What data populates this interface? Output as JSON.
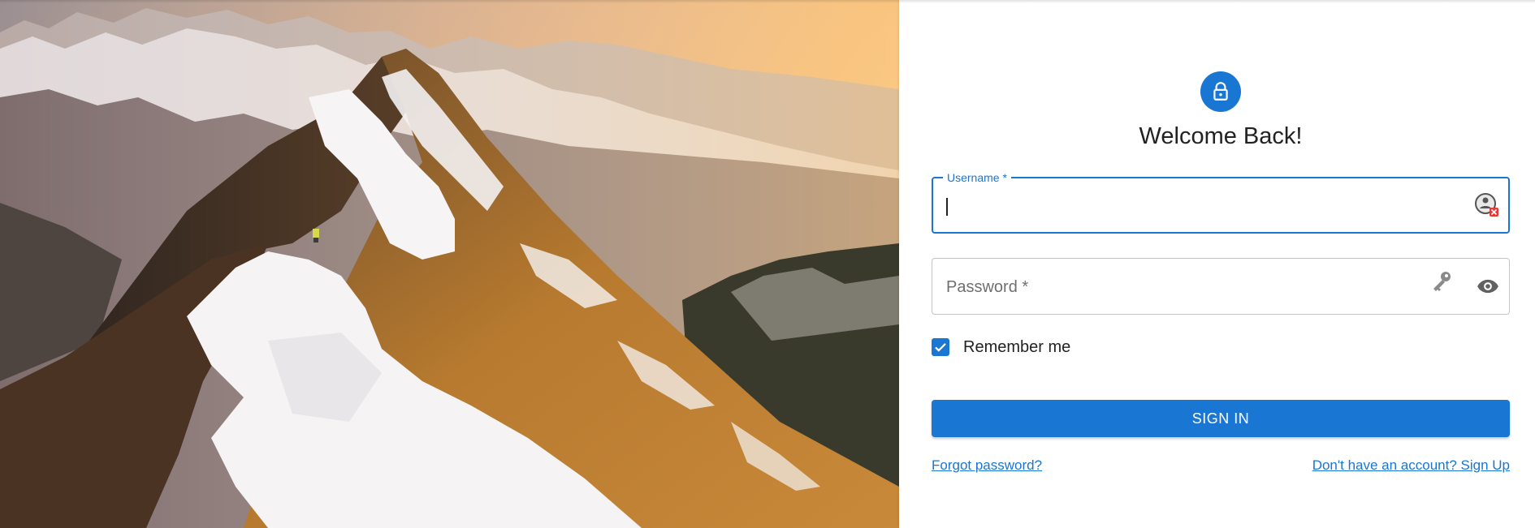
{
  "colors": {
    "primary": "#1976d2",
    "text": "#222222",
    "placeholder": "#6f6f6f",
    "border": "#c4c4c4"
  },
  "hero": {
    "description_icon": "mountain-photo"
  },
  "header": {
    "avatar_icon": "lock-icon",
    "title": "Welcome Back!"
  },
  "form": {
    "username": {
      "label": "Username *",
      "value": "",
      "autofill_icon": "password-manager-icon"
    },
    "password": {
      "label": "Password *",
      "value": "",
      "key_icon": "key-icon",
      "visibility_icon": "eye-icon"
    },
    "remember": {
      "label": "Remember me",
      "checked": true
    },
    "submit_label": "SIGN IN"
  },
  "links": {
    "forgot": "Forgot password?",
    "signup": "Don't have an account? Sign Up"
  }
}
